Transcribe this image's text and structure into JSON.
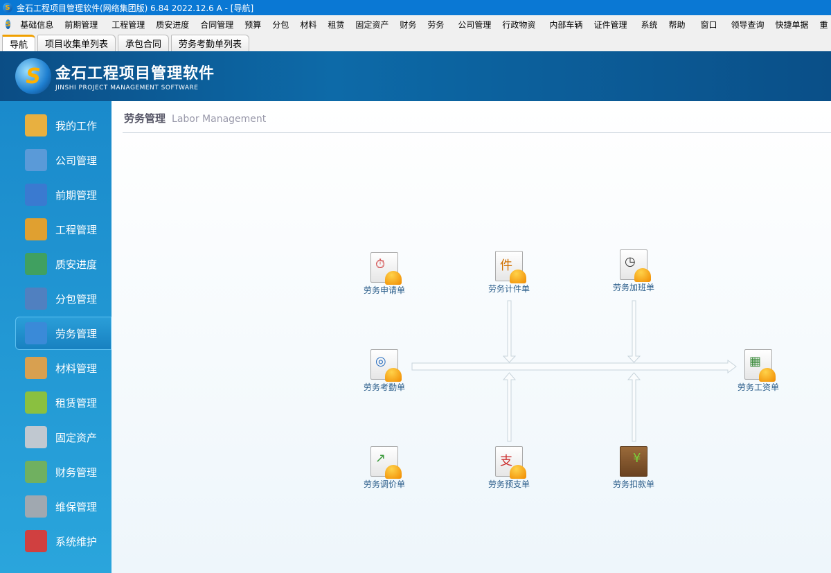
{
  "window": {
    "title": "金石工程项目管理软件(网络集团版) 6.84  2022.12.6 A - [导航]"
  },
  "menu": [
    "基础信息",
    "前期管理",
    "工程管理",
    "质安进度",
    "合同管理",
    "预算",
    "分包",
    "材料",
    "租赁",
    "固定资产",
    "财务",
    "劳务",
    "公司管理",
    "行政物资",
    "内部车辆",
    "证件管理",
    "系统",
    "帮助",
    "窗口",
    "领导查询",
    "快捷单据",
    "重"
  ],
  "tabs": [
    "导航",
    "项目收集单列表",
    "承包合同",
    "劳务考勤单列表"
  ],
  "brand": {
    "name": "金石工程项目管理软件",
    "subtitle": "JINSHI PROJECT MANAGEMENT SOFTWARE"
  },
  "sidebar": [
    {
      "label": "我的工作"
    },
    {
      "label": "公司管理"
    },
    {
      "label": "前期管理"
    },
    {
      "label": "工程管理"
    },
    {
      "label": "质安进度"
    },
    {
      "label": "分包管理"
    },
    {
      "label": "劳务管理",
      "active": true
    },
    {
      "label": "材料管理"
    },
    {
      "label": "租赁管理"
    },
    {
      "label": "固定资产"
    },
    {
      "label": "财务管理"
    },
    {
      "label": "维保管理"
    },
    {
      "label": "系统维护"
    }
  ],
  "page": {
    "title": "劳务管理",
    "subtitle": "Labor Management"
  },
  "nodes": {
    "apply": "劳务申请单",
    "piece": "劳务计件单",
    "overtime": "劳务加班单",
    "attendance": "劳务考勤单",
    "salary": "劳务工资单",
    "price": "劳务调价单",
    "advance": "劳务预支单",
    "deduct": "劳务扣款单"
  }
}
